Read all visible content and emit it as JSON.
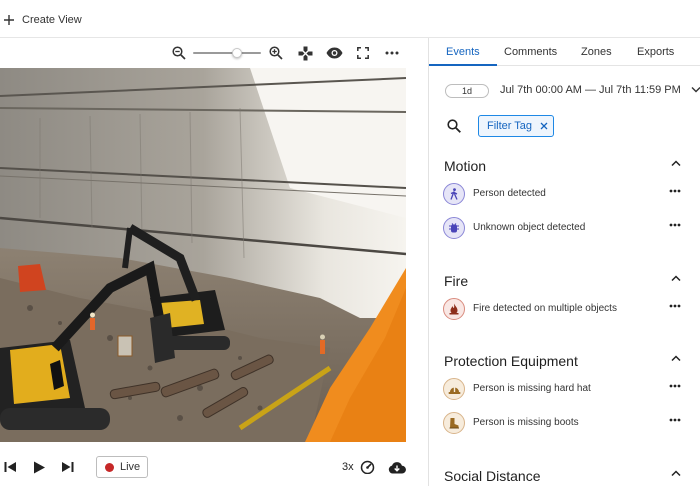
{
  "topbar": {
    "create_view_label": "Create View"
  },
  "video_toolbar": {
    "icons": [
      "zoom-out-icon",
      "zoom-in-icon",
      "gamepad-icon",
      "eye-icon",
      "fullscreen-icon",
      "more-horizontal-icon"
    ],
    "zoom_level": 0.6
  },
  "player": {
    "live_label": "Live",
    "speed_label": "3x",
    "icons": [
      "skip-previous-icon",
      "play-icon",
      "skip-next-icon",
      "speedometer-icon",
      "cloud-download-icon"
    ]
  },
  "tabs": [
    {
      "label": "Events",
      "active": true
    },
    {
      "label": "Comments",
      "active": false
    },
    {
      "label": "Zones",
      "active": false
    },
    {
      "label": "Exports",
      "active": false
    }
  ],
  "range": {
    "chip_label": "1d",
    "text": "Jul 7th 00:00 AM — Jul 7th 11:59 PM"
  },
  "filter": {
    "chip_label": "Filter Tag"
  },
  "sections": [
    {
      "title": "Motion",
      "events": [
        {
          "label": "Person detected",
          "icon": "person-walking-icon"
        },
        {
          "label": "Unknown object detected",
          "icon": "unknown-object-icon"
        }
      ]
    },
    {
      "title": "Fire",
      "events": [
        {
          "label": "Fire detected on multiple objects",
          "icon": "fire-icon"
        }
      ]
    },
    {
      "title": "Protection Equipment",
      "events": [
        {
          "label": "Person is missing hard hat",
          "icon": "hard-hat-icon"
        },
        {
          "label": "Person is missing boots",
          "icon": "boot-icon"
        }
      ]
    },
    {
      "title": "Social Distance",
      "events": []
    }
  ],
  "colors": {
    "accent": "#1565c0",
    "live_dot": "#c62828",
    "motion_icon": "#5a54c4",
    "fire_icon": "#b3452f",
    "ppe_icon": "#b07a2e"
  }
}
